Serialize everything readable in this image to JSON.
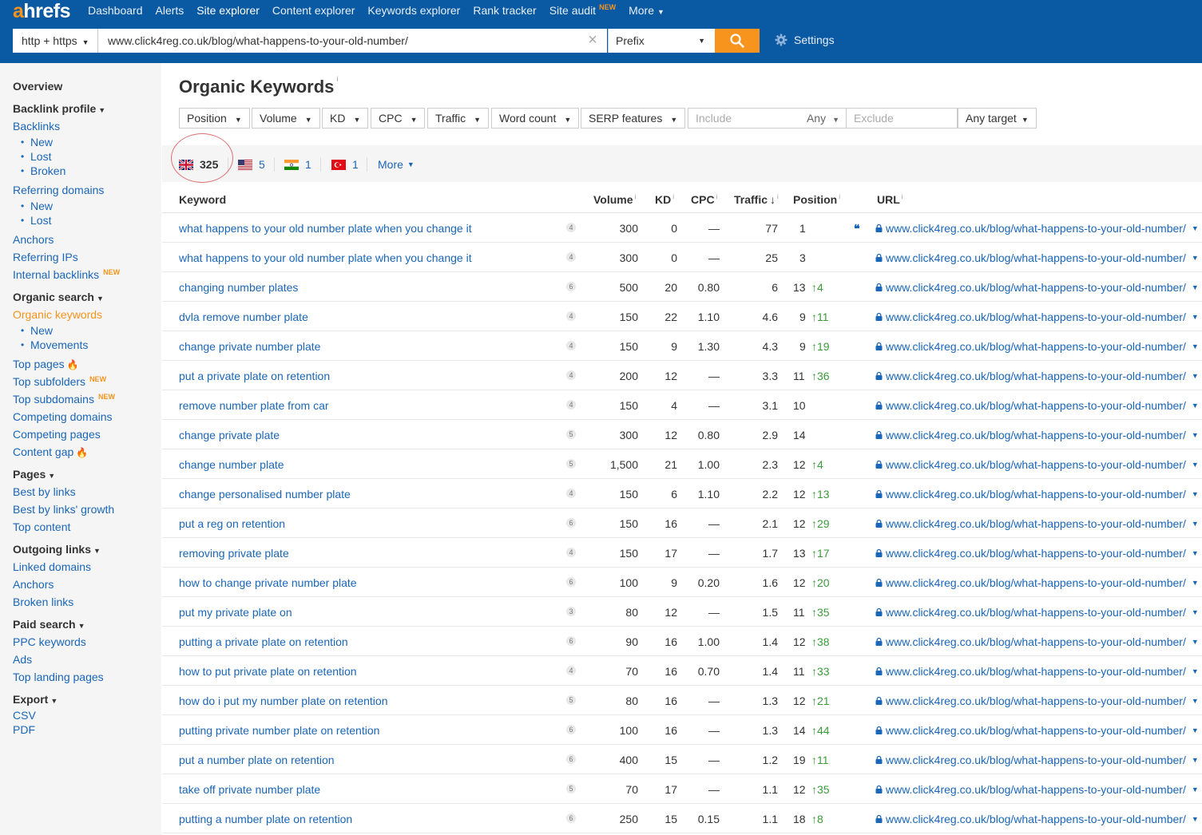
{
  "topbar": {
    "logo_a": "a",
    "logo_rest": "hrefs",
    "nav": [
      {
        "label": "Dashboard"
      },
      {
        "label": "Alerts"
      },
      {
        "label": "Site explorer",
        "active": true
      },
      {
        "label": "Content explorer"
      },
      {
        "label": "Keywords explorer"
      },
      {
        "label": "Rank tracker"
      },
      {
        "label": "Site audit",
        "badge": "NEW"
      },
      {
        "label": "More"
      }
    ],
    "protocol": "http + https",
    "url_value": "www.click4reg.co.uk/blog/what-happens-to-your-old-number/",
    "mode": "Prefix",
    "settings_label": "Settings"
  },
  "sidebar": {
    "overview": "Overview",
    "backlink_profile": "Backlink profile",
    "backlinks": "Backlinks",
    "backlinks_new": "New",
    "backlinks_lost": "Lost",
    "backlinks_broken": "Broken",
    "referring_domains": "Referring domains",
    "rd_new": "New",
    "rd_lost": "Lost",
    "anchors": "Anchors",
    "referring_ips": "Referring IPs",
    "internal_backlinks": "Internal backlinks",
    "new_badge": "NEW",
    "organic_search": "Organic search",
    "organic_keywords": "Organic keywords",
    "ok_new": "New",
    "ok_movements": "Movements",
    "top_pages": "Top pages",
    "top_subfolders": "Top subfolders",
    "top_subdomains": "Top subdomains",
    "competing_domains": "Competing domains",
    "competing_pages": "Competing pages",
    "content_gap": "Content gap",
    "pages": "Pages",
    "best_by_links": "Best by links",
    "best_by_links_growth": "Best by links' growth",
    "top_content": "Top content",
    "outgoing_links": "Outgoing links",
    "linked_domains": "Linked domains",
    "out_anchors": "Anchors",
    "broken_links": "Broken links",
    "paid_search": "Paid search",
    "ppc_keywords": "PPC keywords",
    "ads": "Ads",
    "top_landing_pages": "Top landing pages",
    "export": "Export",
    "csv": "CSV",
    "pdf": "PDF"
  },
  "main": {
    "title": "Organic Keywords",
    "info": "i",
    "filters": {
      "position": "Position",
      "volume": "Volume",
      "kd": "KD",
      "cpc": "CPC",
      "traffic": "Traffic",
      "word_count": "Word count",
      "serp_features": "SERP features",
      "include_placeholder": "Include",
      "any": "Any",
      "exclude_placeholder": "Exclude",
      "any_target": "Any target"
    },
    "countries": {
      "uk": "325",
      "us": "5",
      "in": "1",
      "tr": "1",
      "more": "More"
    },
    "columns": {
      "keyword": "Keyword",
      "volume": "Volume",
      "kd": "KD",
      "cpc": "CPC",
      "traffic": "Traffic",
      "position": "Position",
      "url": "URL"
    },
    "rows": [
      {
        "kw": "what happens to your old number plate when you change it",
        "wc": "4",
        "vol": "300",
        "kd": "0",
        "cpc": "—",
        "traffic": "77",
        "pos": "1",
        "chg": "",
        "quote": true
      },
      {
        "kw": "what happens to your old number plate when you change it",
        "wc": "4",
        "vol": "300",
        "kd": "0",
        "cpc": "—",
        "traffic": "25",
        "pos": "3",
        "chg": ""
      },
      {
        "kw": "changing number plates",
        "wc": "6",
        "vol": "500",
        "kd": "20",
        "cpc": "0.80",
        "traffic": "6",
        "pos": "13",
        "chg": "↑4"
      },
      {
        "kw": "dvla remove number plate",
        "wc": "4",
        "vol": "150",
        "kd": "22",
        "cpc": "1.10",
        "traffic": "4.6",
        "pos": "9",
        "chg": "↑11"
      },
      {
        "kw": "change private number plate",
        "wc": "4",
        "vol": "150",
        "kd": "9",
        "cpc": "1.30",
        "traffic": "4.3",
        "pos": "9",
        "chg": "↑19"
      },
      {
        "kw": "put a private plate on retention",
        "wc": "4",
        "vol": "200",
        "kd": "12",
        "cpc": "—",
        "traffic": "3.3",
        "pos": "11",
        "chg": "↑36"
      },
      {
        "kw": "remove number plate from car",
        "wc": "4",
        "vol": "150",
        "kd": "4",
        "cpc": "—",
        "traffic": "3.1",
        "pos": "10",
        "chg": ""
      },
      {
        "kw": "change private plate",
        "wc": "5",
        "vol": "300",
        "kd": "12",
        "cpc": "0.80",
        "traffic": "2.9",
        "pos": "14",
        "chg": ""
      },
      {
        "kw": "change number plate",
        "wc": "5",
        "vol": "1,500",
        "kd": "21",
        "cpc": "1.00",
        "traffic": "2.3",
        "pos": "12",
        "chg": "↑4"
      },
      {
        "kw": "change personalised number plate",
        "wc": "4",
        "vol": "150",
        "kd": "6",
        "cpc": "1.10",
        "traffic": "2.2",
        "pos": "12",
        "chg": "↑13"
      },
      {
        "kw": "put a reg on retention",
        "wc": "6",
        "vol": "150",
        "kd": "16",
        "cpc": "—",
        "traffic": "2.1",
        "pos": "12",
        "chg": "↑29"
      },
      {
        "kw": "removing private plate",
        "wc": "4",
        "vol": "150",
        "kd": "17",
        "cpc": "—",
        "traffic": "1.7",
        "pos": "13",
        "chg": "↑17"
      },
      {
        "kw": "how to change private number plate",
        "wc": "6",
        "vol": "100",
        "kd": "9",
        "cpc": "0.20",
        "traffic": "1.6",
        "pos": "12",
        "chg": "↑20"
      },
      {
        "kw": "put my private plate on",
        "wc": "3",
        "vol": "80",
        "kd": "12",
        "cpc": "—",
        "traffic": "1.5",
        "pos": "11",
        "chg": "↑35"
      },
      {
        "kw": "putting a private plate on retention",
        "wc": "6",
        "vol": "90",
        "kd": "16",
        "cpc": "1.00",
        "traffic": "1.4",
        "pos": "12",
        "chg": "↑38"
      },
      {
        "kw": "how to put private plate on retention",
        "wc": "4",
        "vol": "70",
        "kd": "16",
        "cpc": "0.70",
        "traffic": "1.4",
        "pos": "11",
        "chg": "↑33"
      },
      {
        "kw": "how do i put my number plate on retention",
        "wc": "5",
        "vol": "80",
        "kd": "16",
        "cpc": "—",
        "traffic": "1.3",
        "pos": "12",
        "chg": "↑21"
      },
      {
        "kw": "putting private number plate on retention",
        "wc": "6",
        "vol": "100",
        "kd": "16",
        "cpc": "—",
        "traffic": "1.3",
        "pos": "14",
        "chg": "↑44"
      },
      {
        "kw": "put a number plate on retention",
        "wc": "6",
        "vol": "400",
        "kd": "15",
        "cpc": "—",
        "traffic": "1.2",
        "pos": "19",
        "chg": "↑11"
      },
      {
        "kw": "take off private number plate",
        "wc": "5",
        "vol": "70",
        "kd": "17",
        "cpc": "—",
        "traffic": "1.1",
        "pos": "12",
        "chg": "↑35"
      },
      {
        "kw": "putting a number plate on retention",
        "wc": "6",
        "vol": "250",
        "kd": "15",
        "cpc": "0.15",
        "traffic": "1.1",
        "pos": "18",
        "chg": "↑8"
      }
    ],
    "row_url": "www.click4reg.co.uk/blog/what-happens-to-your-old-number/"
  }
}
